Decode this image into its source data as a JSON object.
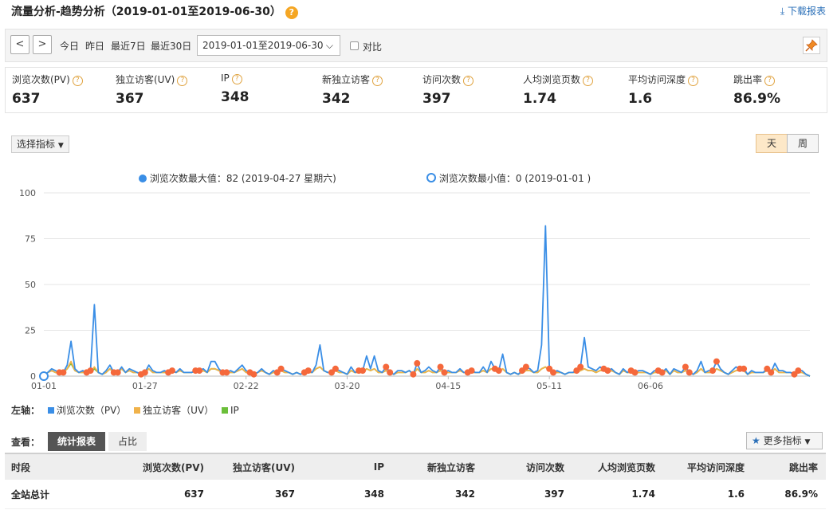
{
  "header": {
    "title": "流量分析-趋势分析（2019-01-01至2019-06-30）",
    "help_icon": "?",
    "download_label": "下载报表"
  },
  "toolbar": {
    "prev_icon": "<",
    "next_icon": ">",
    "quick_ranges": [
      "今日",
      "昨日",
      "最近7日",
      "最近30日"
    ],
    "date_range": "2019-01-01至2019-06-30",
    "compare_label": "对比"
  },
  "metrics": [
    {
      "label": "浏览次数(PV)",
      "value": "637"
    },
    {
      "label": "独立访客(UV)",
      "value": "367"
    },
    {
      "label": "IP",
      "value": "348"
    },
    {
      "label": "新独立访客",
      "value": "342"
    },
    {
      "label": "访问次数",
      "value": "397"
    },
    {
      "label": "人均浏览页数",
      "value": "1.74"
    },
    {
      "label": "平均访问深度",
      "value": "1.6"
    },
    {
      "label": "跳出率",
      "value": "86.9%"
    }
  ],
  "chart_controls": {
    "select_metric_label": "选择指标",
    "granularity": [
      "天",
      "周"
    ],
    "selected_granularity": "天"
  },
  "chart_data": {
    "type": "line",
    "annotations": {
      "max": "浏览次数最大值：82 (2019-04-27 星期六)",
      "min": "浏览次数最小值：0 (2019-01-01 )"
    },
    "y_ticks": [
      "100",
      "75",
      "50",
      "25",
      "0"
    ],
    "ylim": [
      0,
      100
    ],
    "x_tick_labels": [
      "01-01",
      "01-27",
      "02-22",
      "03-20",
      "04-15",
      "05-11",
      "06-06"
    ],
    "x_tick_days": [
      0,
      26,
      52,
      78,
      104,
      130,
      156
    ],
    "axis_label": "左轴：",
    "series": [
      {
        "name": "浏览次数（PV）",
        "color": "#3a8ee6",
        "values": [
          0,
          2,
          4,
          3,
          2,
          2,
          6,
          19,
          4,
          2,
          3,
          2,
          3,
          39,
          2,
          1,
          3,
          6,
          2,
          2,
          5,
          2,
          4,
          3,
          2,
          1,
          2,
          6,
          3,
          2,
          2,
          3,
          2,
          3,
          2,
          4,
          2,
          2,
          2,
          3,
          3,
          4,
          2,
          8,
          8,
          4,
          2,
          2,
          3,
          2,
          4,
          6,
          3,
          2,
          1,
          2,
          4,
          2,
          1,
          3,
          2,
          4,
          3,
          2,
          1,
          2,
          1,
          2,
          3,
          2,
          6,
          17,
          3,
          2,
          2,
          4,
          3,
          2,
          1,
          5,
          2,
          3,
          3,
          11,
          4,
          11,
          3,
          2,
          5,
          2,
          1,
          3,
          3,
          2,
          3,
          1,
          7,
          2,
          3,
          5,
          3,
          2,
          5,
          2,
          3,
          2,
          2,
          4,
          2,
          2,
          3,
          2,
          2,
          5,
          2,
          8,
          4,
          3,
          12,
          2,
          1,
          2,
          1,
          3,
          5,
          4,
          2,
          3,
          17,
          82,
          4,
          2,
          3,
          2,
          1,
          2,
          2,
          3,
          5,
          21,
          5,
          4,
          3,
          5,
          4,
          3,
          4,
          2,
          1,
          4,
          2,
          3,
          2,
          3,
          3,
          2,
          1,
          3,
          3,
          2,
          4,
          1,
          4,
          3,
          2,
          5,
          2,
          1,
          3,
          8,
          2,
          3,
          3,
          8,
          4,
          2,
          1,
          3,
          5,
          4,
          4,
          1,
          3,
          2,
          2,
          2,
          4,
          2,
          7,
          3,
          3,
          2,
          2,
          1,
          3,
          3,
          1,
          0
        ],
        "total": "637"
      },
      {
        "name": "独立访客（UV）",
        "color": "#f0b24a",
        "values": [
          0,
          2,
          3,
          2,
          2,
          2,
          4,
          8,
          3,
          2,
          2,
          2,
          2,
          5,
          2,
          1,
          2,
          4,
          2,
          2,
          4,
          2,
          3,
          2,
          2,
          1,
          2,
          4,
          2,
          2,
          2,
          2,
          2,
          3,
          2,
          3,
          2,
          2,
          2,
          3,
          2,
          3,
          2,
          4,
          4,
          3,
          2,
          2,
          2,
          2,
          3,
          4,
          2,
          2,
          1,
          2,
          3,
          2,
          1,
          2,
          2,
          3,
          2,
          2,
          1,
          2,
          1,
          2,
          2,
          2,
          4,
          5,
          3,
          2,
          2,
          3,
          2,
          2,
          1,
          3,
          2,
          2,
          2,
          4,
          3,
          4,
          2,
          2,
          3,
          2,
          1,
          2,
          2,
          2,
          3,
          1,
          4,
          2,
          2,
          3,
          2,
          2,
          3,
          2,
          2,
          2,
          2,
          3,
          2,
          2,
          2,
          2,
          2,
          3,
          2,
          4,
          3,
          2,
          4,
          2,
          1,
          2,
          1,
          2,
          3,
          3,
          2,
          2,
          4,
          5,
          3,
          2,
          2,
          2,
          1,
          2,
          2,
          2,
          3,
          4,
          3,
          3,
          2,
          3,
          3,
          2,
          3,
          2,
          1,
          3,
          2,
          2,
          2,
          2,
          2,
          2,
          1,
          2,
          2,
          2,
          3,
          1,
          3,
          2,
          2,
          3,
          2,
          1,
          2,
          4,
          2,
          2,
          2,
          4,
          3,
          2,
          1,
          2,
          3,
          3,
          3,
          1,
          2,
          2,
          2,
          2,
          3,
          2,
          4,
          2,
          2,
          2,
          2,
          1,
          2,
          2,
          1,
          0
        ],
        "total": "367"
      },
      {
        "name": "IP",
        "color": "#6bbf3a",
        "values": [
          0,
          2,
          3,
          2,
          2,
          2,
          4,
          7,
          3,
          2,
          2,
          2,
          2,
          4,
          2,
          1,
          2,
          4,
          2,
          2,
          4,
          2,
          3,
          2,
          2,
          1,
          2,
          4,
          2,
          2,
          2,
          2,
          2,
          3,
          2,
          3,
          2,
          2,
          2,
          3,
          2,
          3,
          2,
          4,
          4,
          3,
          2,
          2,
          2,
          2,
          3,
          4,
          2,
          2,
          1,
          2,
          3,
          2,
          1,
          2,
          2,
          3,
          2,
          2,
          1,
          2,
          1,
          2,
          2,
          2,
          4,
          5,
          3,
          2,
          2,
          3,
          2,
          2,
          1,
          3,
          2,
          2,
          2,
          4,
          3,
          4,
          2,
          2,
          3,
          2,
          1,
          2,
          2,
          2,
          3,
          1,
          4,
          2,
          2,
          3,
          2,
          2,
          3,
          2,
          2,
          2,
          2,
          3,
          2,
          2,
          2,
          2,
          2,
          3,
          2,
          4,
          3,
          2,
          4,
          2,
          1,
          2,
          1,
          2,
          3,
          3,
          2,
          2,
          4,
          5,
          3,
          2,
          2,
          2,
          1,
          2,
          2,
          2,
          3,
          4,
          3,
          3,
          2,
          3,
          3,
          2,
          3,
          2,
          1,
          3,
          2,
          2,
          2,
          2,
          2,
          2,
          1,
          2,
          2,
          2,
          3,
          1,
          3,
          2,
          2,
          3,
          2,
          1,
          2,
          4,
          2,
          2,
          2,
          4,
          3,
          2,
          1,
          2,
          3,
          3,
          3,
          1,
          2,
          2,
          2,
          2,
          3,
          2,
          4,
          2,
          2,
          2,
          2,
          1,
          2,
          2,
          1,
          0
        ],
        "total": "348"
      }
    ]
  },
  "bottom": {
    "view_label": "查看：",
    "tabs": [
      "统计报表",
      "占比"
    ],
    "more_metrics_label": "更多指标",
    "table": {
      "headers": [
        "时段",
        "浏览次数(PV)",
        "独立访客(UV)",
        "IP",
        "新独立访客",
        "访问次数",
        "人均浏览页数",
        "平均访问深度",
        "跳出率"
      ],
      "rows": [
        [
          "全站总计",
          "637",
          "367",
          "348",
          "342",
          "397",
          "1.74",
          "1.6",
          "86.9%"
        ]
      ]
    }
  }
}
